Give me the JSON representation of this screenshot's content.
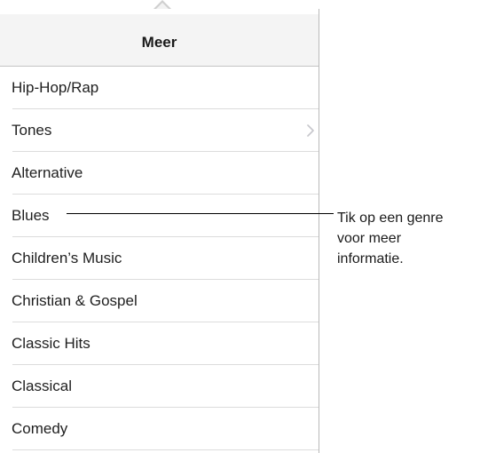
{
  "header": {
    "title": "Meer"
  },
  "genres": [
    {
      "label": "Hip-Hop/Rap",
      "has_chevron": false
    },
    {
      "label": "Tones",
      "has_chevron": true
    },
    {
      "label": "Alternative",
      "has_chevron": false
    },
    {
      "label": "Blues",
      "has_chevron": false
    },
    {
      "label": "Children’s Music",
      "has_chevron": false
    },
    {
      "label": "Christian & Gospel",
      "has_chevron": false
    },
    {
      "label": "Classic Hits",
      "has_chevron": false
    },
    {
      "label": "Classical",
      "has_chevron": false
    },
    {
      "label": "Comedy",
      "has_chevron": false
    }
  ],
  "callout": {
    "lines": [
      "Tik op een genre",
      "voor meer",
      "informatie."
    ]
  },
  "icons": {
    "chevron": "chevron-right-icon"
  },
  "colors": {
    "header_bg": "#f4f4f4",
    "separator": "#dcdcdc",
    "chevron": "#c7c7cc"
  }
}
